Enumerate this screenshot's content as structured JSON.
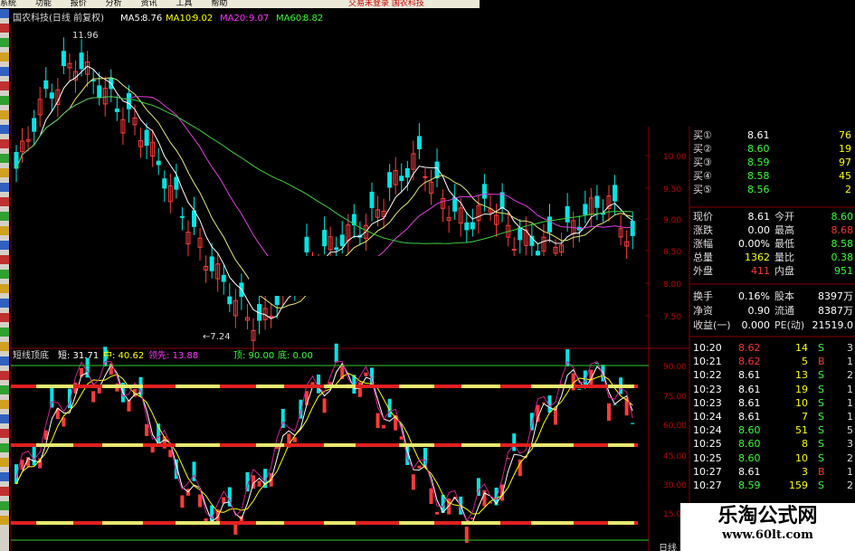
{
  "menu": {
    "items": [
      "系统",
      "功能",
      "报价",
      "分析",
      "资讯",
      "工具",
      "帮助"
    ],
    "right": "交易未登录  国农科技"
  },
  "main_header": {
    "title": "国农科技(日线 前复权)",
    "ma5_label": "MA5:",
    "ma5": "8.76",
    "ma10_label": "MA10:",
    "ma10": "9.02",
    "ma20_label": "MA20:",
    "ma20": "9.07",
    "ma60_label": "MA60:",
    "ma60": "8.82"
  },
  "annotations": {
    "high": "11.96",
    "low": "←7.24"
  },
  "price_axis": [
    "10.00",
    "9.50",
    "9.00",
    "8.50",
    "8.00",
    "7.50"
  ],
  "sub_header": {
    "title": "短线顶底",
    "short": "短: 31.71",
    "mid": "中: 40.62",
    "lead": "领先: 13.88",
    "top": "顶: 90.00",
    "bottom": "底: 0.00"
  },
  "osc_axis": [
    "90.00",
    "75.00",
    "60.00",
    "45.00",
    "30.00",
    "15.00"
  ],
  "colors": {
    "up": "#ff3b3b",
    "down": "#00e5e5",
    "ma5": "#ffffff",
    "ma10": "#e8e870",
    "ma20": "#e040e0",
    "ma60": "#40d040",
    "grid": "#8a0000"
  },
  "orderbook": [
    {
      "label": "买①",
      "price": "8.61",
      "vol": "76",
      "pc": "#fff"
    },
    {
      "label": "买②",
      "price": "8.60",
      "vol": "19",
      "pc": "#3f3"
    },
    {
      "label": "买③",
      "price": "8.59",
      "vol": "97",
      "pc": "#3f3"
    },
    {
      "label": "买④",
      "price": "8.58",
      "vol": "45",
      "pc": "#3f3"
    },
    {
      "label": "买⑤",
      "price": "8.56",
      "vol": "2",
      "pc": "#3f3"
    }
  ],
  "stats": [
    {
      "l1": "现价",
      "v1": "8.61",
      "l2": "今开",
      "v2": "8.60",
      "c1": "#fff",
      "c2": "#3f3"
    },
    {
      "l1": "涨跌",
      "v1": "0.00",
      "l2": "最高",
      "v2": "8.68",
      "c1": "#fff",
      "c2": "#f33"
    },
    {
      "l1": "涨幅",
      "v1": "0.00%",
      "l2": "最低",
      "v2": "8.58",
      "c1": "#fff",
      "c2": "#3f3"
    },
    {
      "l1": "总量",
      "v1": "1362",
      "l2": "量比",
      "v2": "0.38",
      "c1": "#ff0",
      "c2": "#3f3"
    },
    {
      "l1": "外盘",
      "v1": "411",
      "l2": "内盘",
      "v2": "951",
      "c1": "#f33",
      "c2": "#3f3"
    }
  ],
  "stats2": [
    {
      "l1": "换手",
      "v1": "0.16%",
      "l2": "股本",
      "v2": "8397万"
    },
    {
      "l1": "净资",
      "v1": "0.90",
      "l2": "流通",
      "v2": "8387万"
    },
    {
      "l1": "收益(一)",
      "v1": "0.000",
      "l2": "PE(动)",
      "v2": "21519.0"
    }
  ],
  "ticks": [
    {
      "t": "10:20",
      "p": "8.62",
      "v": "14",
      "s": "S",
      "n": "3"
    },
    {
      "t": "10:21",
      "p": "8.62",
      "v": "5",
      "s": "B",
      "n": "1"
    },
    {
      "t": "10:22",
      "p": "8.61",
      "v": "13",
      "s": "S",
      "n": "2"
    },
    {
      "t": "10:23",
      "p": "8.61",
      "v": "19",
      "s": "S",
      "n": "1"
    },
    {
      "t": "10:23",
      "p": "8.61",
      "v": "10",
      "s": "S",
      "n": "1"
    },
    {
      "t": "10:24",
      "p": "8.61",
      "v": "7",
      "s": "S",
      "n": "1"
    },
    {
      "t": "10:24",
      "p": "8.60",
      "v": "51",
      "s": "S",
      "n": "5"
    },
    {
      "t": "10:25",
      "p": "8.60",
      "v": "8",
      "s": "S",
      "n": "3"
    },
    {
      "t": "10:25",
      "p": "8.60",
      "v": "10",
      "s": "S",
      "n": "2"
    },
    {
      "t": "10:27",
      "p": "8.61",
      "v": "3",
      "s": "B",
      "n": "1"
    },
    {
      "t": "10:27",
      "p": "8.59",
      "v": "159",
      "s": "S",
      "n": "2"
    }
  ],
  "watermark": {
    "title": "乐淘公式网",
    "url": "www.60lt.com"
  },
  "bottom_label": "日线"
}
